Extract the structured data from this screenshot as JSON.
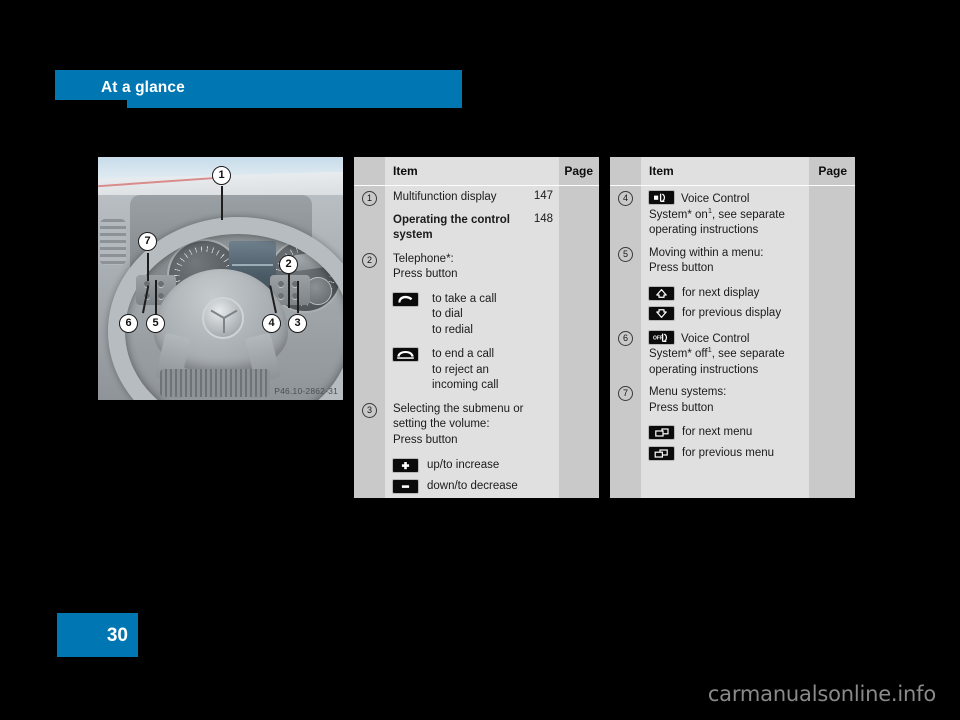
{
  "header": {
    "title": "At a glance"
  },
  "figure": {
    "name": "steering-wheel-controls",
    "part_code": "P46.10-2862-31",
    "callouts": [
      "1",
      "2",
      "3",
      "4",
      "5",
      "6",
      "7"
    ]
  },
  "tables": [
    {
      "id": "middle",
      "columns": {
        "item": "Item",
        "page": "Page"
      },
      "rows": [
        {
          "number": "1",
          "text": "Multifunction display",
          "page": "147",
          "bold": false,
          "subitems": []
        },
        {
          "number": "",
          "text": "Operating the control\nsystem",
          "page": "148",
          "bold": true,
          "subitems": []
        },
        {
          "number": "2",
          "text": "Telephone*:\nPress button",
          "page": "",
          "bold": false,
          "subitems": [
            {
              "icon": "phone-handset-raised-icon",
              "label": "to take a call\nto dial\nto redial"
            },
            {
              "icon": "phone-handset-lowered-icon",
              "label": "to end a call\nto reject an\nincoming call"
            }
          ]
        },
        {
          "number": "3",
          "text": "Selecting the submenu or\nsetting the volume:\nPress button",
          "page": "",
          "bold": false,
          "subitems": [
            {
              "icon": "plus-icon",
              "label": "up/to increase"
            },
            {
              "icon": "minus-icon",
              "label": "down/to decrease"
            }
          ]
        }
      ]
    },
    {
      "id": "right",
      "columns": {
        "item": "Item",
        "page": "Page"
      },
      "rows": [
        {
          "number": "4",
          "inline_icon": "voice-control-on-icon",
          "text_before_icon": "",
          "text": "Voice Control\nSystem* on",
          "footnote": "1",
          "text_after": ", see separate\noperating instructions",
          "page": "",
          "bold": false,
          "subitems": []
        },
        {
          "number": "5",
          "text": "Moving within a menu:\nPress button",
          "page": "",
          "bold": false,
          "subitems": [
            {
              "icon": "arrow-up-icon",
              "label": "for next display"
            },
            {
              "icon": "arrow-down-icon",
              "label": "for previous display"
            }
          ]
        },
        {
          "number": "6",
          "inline_icon": "voice-control-off-icon",
          "text": "Voice Control\nSystem* off",
          "footnote": "1",
          "text_after": ", see separate\noperating instructions",
          "page": "",
          "bold": false,
          "subitems": []
        },
        {
          "number": "7",
          "text": "Menu systems:\nPress button",
          "page": "",
          "bold": false,
          "subitems": [
            {
              "icon": "next-menu-icon",
              "label": "for next menu"
            },
            {
              "icon": "previous-menu-icon",
              "label": "for previous menu"
            }
          ]
        }
      ]
    }
  ],
  "footer": {
    "page_number": "30",
    "watermark": "carmanualsonline.info"
  },
  "colors": {
    "accent": "#0077B3",
    "table_bg": "#c9c9c9",
    "table_body_bg": "#e0e0e0",
    "icon_bg": "#0b0b0b"
  }
}
